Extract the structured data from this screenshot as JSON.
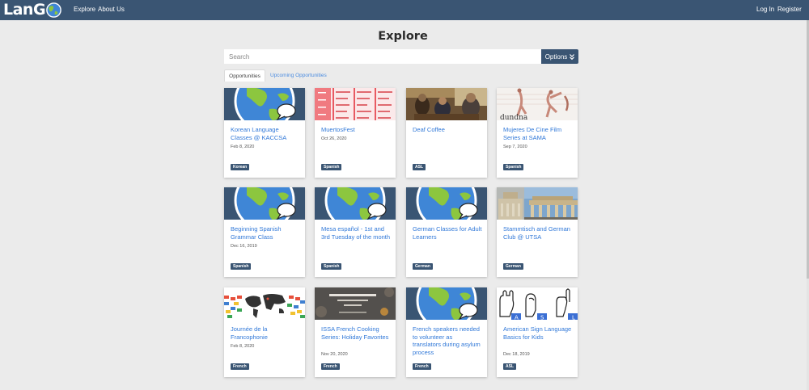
{
  "nav": {
    "logo_text": "LanG",
    "links": [
      {
        "label": "Explore"
      },
      {
        "label": "About Us"
      },
      {
        "label": "Log In"
      },
      {
        "label": "Register"
      }
    ]
  },
  "page": {
    "title": "Explore",
    "search_placeholder": "Search",
    "options_label": "Options",
    "options_icon": "double-chevron-down-icon"
  },
  "tabs": [
    {
      "label": "Opportunities",
      "active": true
    },
    {
      "label": "Upcoming Opportunities",
      "active": false
    }
  ],
  "cards": [
    {
      "title": "Korean Language Classes @ KACCSA",
      "date": "Feb 8, 2020",
      "language": "Korean",
      "image": "globe"
    },
    {
      "title": "MuertosFest",
      "date": "Oct 26, 2020",
      "language": "Spanish",
      "image": "schedule"
    },
    {
      "title": "Deaf Coffee",
      "date": "",
      "language": "ASL",
      "image": "cafe"
    },
    {
      "title": "Mujeres De Cine Film Series at SAMA",
      "date": "Sep 7, 2020",
      "language": "Spanish",
      "image": "dancers"
    },
    {
      "title": "Beginning Spanish Grammar Class",
      "date": "Dec 16, 2019",
      "language": "Spanish",
      "image": "globe"
    },
    {
      "title": "Mesa español - 1st and 3rd Tuesday of the month",
      "date": "",
      "language": "Spanish",
      "image": "globe"
    },
    {
      "title": "German Classes for Adult Learners",
      "date": "",
      "language": "German",
      "image": "globe"
    },
    {
      "title": "Stammtisch and German Club @ UTSA",
      "date": "",
      "language": "German",
      "image": "berlin"
    },
    {
      "title": "Journée de la Francophonie",
      "date": "Feb 8, 2020",
      "language": "French",
      "image": "worldmap"
    },
    {
      "title": "ISSA French Cooking Series: Holiday Favorites",
      "date": "Nov 20, 2020",
      "language": "French",
      "image": "cooking"
    },
    {
      "title": "French speakers needed to volunteer as translators during asylum process",
      "date": "",
      "language": "French",
      "image": "globe"
    },
    {
      "title": "American Sign Language Basics for Kids",
      "date": "Dec 18, 2019",
      "language": "ASL",
      "image": "asl"
    }
  ],
  "colors": {
    "brand": "#3a5573",
    "link": "#3078d8",
    "background": "#ebebeb"
  }
}
